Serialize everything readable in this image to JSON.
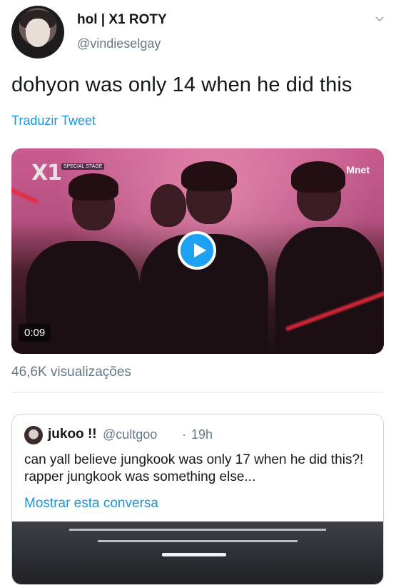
{
  "tweet": {
    "display_name": "hol | X1 ROTY",
    "handle": "@vindieselgay",
    "text": "dohyon was only 14 when he did this",
    "translate_label": "Traduzir Tweet"
  },
  "video": {
    "duration": "0:09",
    "overlay_x1": "X1",
    "overlay_special_stage": "SPECIAL STAGE",
    "overlay_brand": "Mnet"
  },
  "stats": {
    "views": "46,6K visualizações"
  },
  "quote": {
    "display_name": "jukoo !!",
    "handle": "@cultgoo",
    "separator": "·",
    "time": "19h",
    "text": "can yall believe jungkook was only 17 when he did this?! rapper jungkook was something else...",
    "show_thread_label": "Mostrar esta conversa"
  },
  "colors": {
    "link": "#1b95e0",
    "play_button": "#1da1f2",
    "secondary_text": "#657786"
  },
  "icons": {
    "menu": "chevron-down-icon",
    "play": "play-icon"
  }
}
